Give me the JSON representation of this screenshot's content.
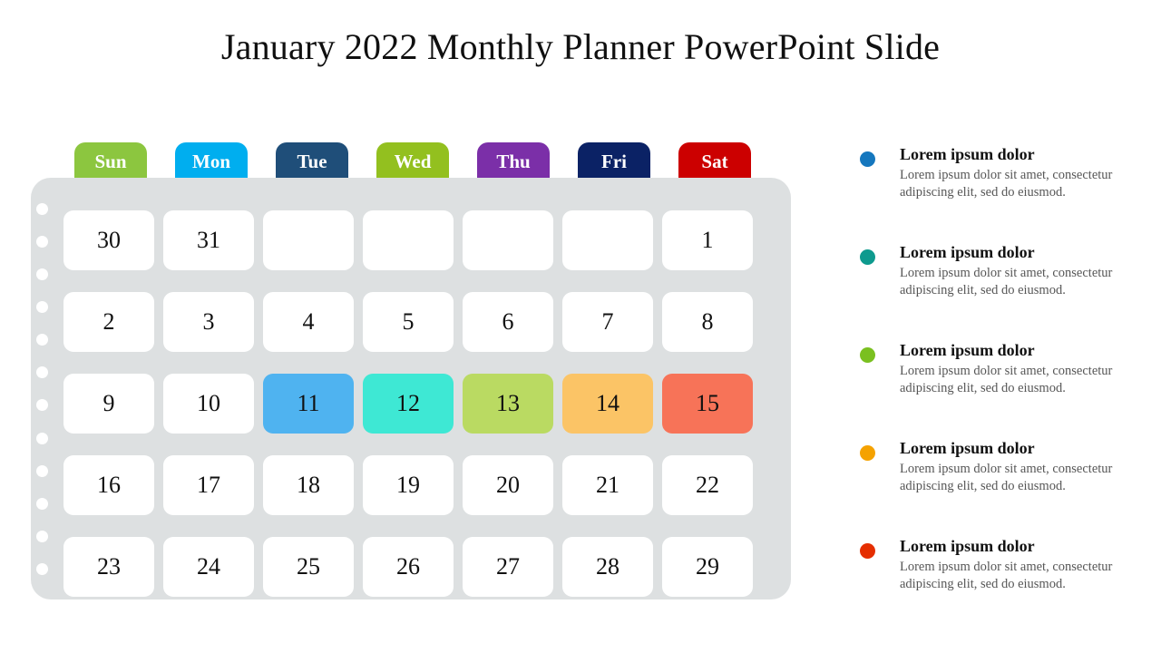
{
  "slide": {
    "title": "January 2022 Monthly Planner PowerPoint Slide",
    "background_color": "#ffffff"
  },
  "calendar": {
    "panel_color": "#dde0e1",
    "binding_hole_count": 12,
    "weekdays": [
      {
        "label": "Sun",
        "color": "#8cc63f"
      },
      {
        "label": "Mon",
        "color": "#00aeef"
      },
      {
        "label": "Tue",
        "color": "#1f4e79"
      },
      {
        "label": "Wed",
        "color": "#93c01f"
      },
      {
        "label": "Thu",
        "color": "#7b2fa8"
      },
      {
        "label": "Fri",
        "color": "#0b2265"
      },
      {
        "label": "Sat",
        "color": "#cc0000"
      }
    ],
    "weeks": [
      [
        {
          "day": "30",
          "color": "#ffffff"
        },
        {
          "day": "31",
          "color": "#ffffff"
        },
        {
          "day": "",
          "color": "#ffffff"
        },
        {
          "day": "",
          "color": "#ffffff"
        },
        {
          "day": "",
          "color": "#ffffff"
        },
        {
          "day": "",
          "color": "#ffffff"
        },
        {
          "day": "1",
          "color": "#ffffff"
        }
      ],
      [
        {
          "day": "2",
          "color": "#ffffff"
        },
        {
          "day": "3",
          "color": "#ffffff"
        },
        {
          "day": "4",
          "color": "#ffffff"
        },
        {
          "day": "5",
          "color": "#ffffff"
        },
        {
          "day": "6",
          "color": "#ffffff"
        },
        {
          "day": "7",
          "color": "#ffffff"
        },
        {
          "day": "8",
          "color": "#ffffff"
        }
      ],
      [
        {
          "day": "9",
          "color": "#ffffff"
        },
        {
          "day": "10",
          "color": "#ffffff"
        },
        {
          "day": "11",
          "color": "#4fb3f0"
        },
        {
          "day": "12",
          "color": "#3ee8d4"
        },
        {
          "day": "13",
          "color": "#bada62"
        },
        {
          "day": "14",
          "color": "#fbc466"
        },
        {
          "day": "15",
          "color": "#f77358"
        }
      ],
      [
        {
          "day": "16",
          "color": "#ffffff"
        },
        {
          "day": "17",
          "color": "#ffffff"
        },
        {
          "day": "18",
          "color": "#ffffff"
        },
        {
          "day": "19",
          "color": "#ffffff"
        },
        {
          "day": "20",
          "color": "#ffffff"
        },
        {
          "day": "21",
          "color": "#ffffff"
        },
        {
          "day": "22",
          "color": "#ffffff"
        }
      ],
      [
        {
          "day": "23",
          "color": "#ffffff"
        },
        {
          "day": "24",
          "color": "#ffffff"
        },
        {
          "day": "25",
          "color": "#ffffff"
        },
        {
          "day": "26",
          "color": "#ffffff"
        },
        {
          "day": "27",
          "color": "#ffffff"
        },
        {
          "day": "28",
          "color": "#ffffff"
        },
        {
          "day": "29",
          "color": "#ffffff"
        }
      ]
    ]
  },
  "legend": {
    "items": [
      {
        "dot_color": "#1577be",
        "heading": "Lorem ipsum dolor",
        "body": "Lorem ipsum dolor sit amet, consectetur adipiscing elit, sed do eiusmod."
      },
      {
        "dot_color": "#0e9a8e",
        "heading": "Lorem ipsum dolor",
        "body": "Lorem ipsum dolor sit amet, consectetur adipiscing elit, sed do eiusmod."
      },
      {
        "dot_color": "#7ac020",
        "heading": "Lorem ipsum dolor",
        "body": "Lorem ipsum dolor sit amet, consectetur adipiscing elit, sed do eiusmod."
      },
      {
        "dot_color": "#f5a200",
        "heading": "Lorem ipsum dolor",
        "body": "Lorem ipsum dolor sit amet, consectetur adipiscing elit, sed do eiusmod."
      },
      {
        "dot_color": "#e52e00",
        "heading": "Lorem ipsum dolor",
        "body": "Lorem ipsum dolor sit amet, consectetur adipiscing elit, sed do eiusmod."
      }
    ]
  }
}
